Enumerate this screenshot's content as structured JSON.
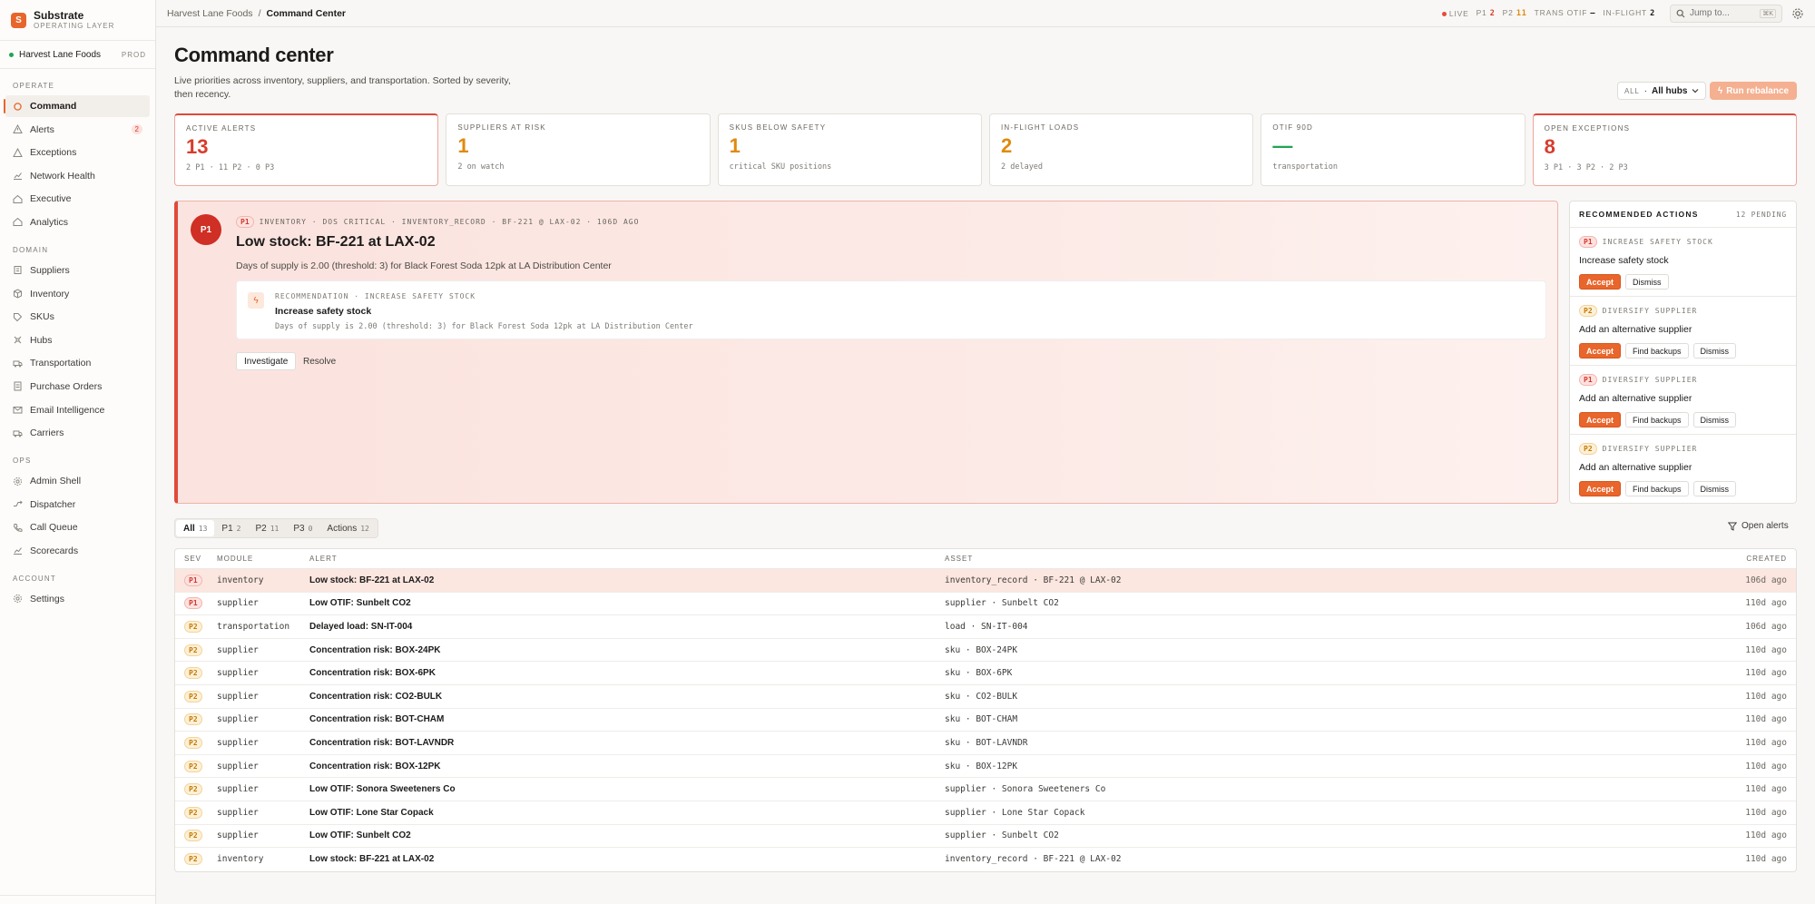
{
  "brand": {
    "name": "Substrate",
    "subtitle": "OPERATING LAYER",
    "logo_letter": "S"
  },
  "org": {
    "name": "Harvest Lane Foods",
    "env": "PROD"
  },
  "nav": {
    "sections": [
      {
        "label": "OPERATE",
        "items": [
          {
            "label": "Command",
            "icon": "circle-icon",
            "active": true
          },
          {
            "label": "Alerts",
            "icon": "warning-icon",
            "badge": "2"
          },
          {
            "label": "Exceptions",
            "icon": "triangle-icon"
          },
          {
            "label": "Network Health",
            "icon": "chart-icon"
          },
          {
            "label": "Executive",
            "icon": "home-icon"
          },
          {
            "label": "Analytics",
            "icon": "home-icon"
          }
        ]
      },
      {
        "label": "DOMAIN",
        "items": [
          {
            "label": "Suppliers",
            "icon": "building-icon"
          },
          {
            "label": "Inventory",
            "icon": "box-icon"
          },
          {
            "label": "SKUs",
            "icon": "tag-icon"
          },
          {
            "label": "Hubs",
            "icon": "hub-icon"
          },
          {
            "label": "Transportation",
            "icon": "truck-icon"
          },
          {
            "label": "Purchase Orders",
            "icon": "document-icon"
          },
          {
            "label": "Email Intelligence",
            "icon": "mail-icon"
          },
          {
            "label": "Carriers",
            "icon": "truck-icon"
          }
        ]
      },
      {
        "label": "OPS",
        "items": [
          {
            "label": "Admin Shell",
            "icon": "gear-icon"
          },
          {
            "label": "Dispatcher",
            "icon": "route-icon"
          },
          {
            "label": "Call Queue",
            "icon": "phone-icon"
          },
          {
            "label": "Scorecards",
            "icon": "chart-icon"
          }
        ]
      },
      {
        "label": "ACCOUNT",
        "items": [
          {
            "label": "Settings",
            "icon": "gear-icon"
          }
        ]
      }
    ]
  },
  "topbar": {
    "breadcrumb": [
      "Harvest Lane Foods",
      "Command Center"
    ],
    "live_label": "LIVE",
    "p1_label": "P1",
    "p1_count": "2",
    "p2_label": "P2",
    "p2_count": "11",
    "otif_label": "TRANS OTIF",
    "otif_value": "—",
    "inflight_label": "IN-FLIGHT",
    "inflight_value": "2",
    "jump_placeholder": "Jump to...",
    "jump_kbd": "⌘K"
  },
  "header": {
    "title": "Command center",
    "subtitle": "Live priorities across inventory, suppliers, and transportation. Sorted by severity, then recency.",
    "hub_filter_label": "ALL",
    "hub_filter_value": "All hubs",
    "rebalance_label": "Run rebalance"
  },
  "kpis": [
    {
      "label": "ACTIVE ALERTS",
      "value": "13",
      "sub": "2 P1 · 11 P2 · 0 P3",
      "color": "red",
      "highlight": true
    },
    {
      "label": "SUPPLIERS AT RISK",
      "value": "1",
      "sub": "2 on watch",
      "color": "amber"
    },
    {
      "label": "SKUS BELOW SAFETY",
      "value": "1",
      "sub": "critical SKU positions",
      "color": "amber"
    },
    {
      "label": "IN-FLIGHT LOADS",
      "value": "2",
      "sub": "2 delayed",
      "color": "amber"
    },
    {
      "label": "OTIF 90D",
      "value": "—",
      "sub": "transportation",
      "color": "green"
    },
    {
      "label": "OPEN EXCEPTIONS",
      "value": "8",
      "sub": "3 P1 · 3 P2 · 2 P3",
      "color": "red",
      "highlight": true
    }
  ],
  "featured_alert": {
    "severity": "P1",
    "meta_pill": "P1",
    "meta": "INVENTORY · DOS CRITICAL · INVENTORY_RECORD · BF-221 @ LAX-02 · 106D AGO",
    "title": "Low stock: BF-221 at LAX-02",
    "description": "Days of supply is 2.00 (threshold: 3) for Black Forest Soda 12pk at LA Distribution Center",
    "recommendation": {
      "meta": "RECOMMENDATION · INCREASE SAFETY STOCK",
      "title": "Increase safety stock",
      "description": "Days of supply is 2.00 (threshold: 3) for Black Forest Soda 12pk at LA Distribution Center"
    },
    "investigate_label": "Investigate",
    "resolve_label": "Resolve"
  },
  "recommended_actions": {
    "title": "RECOMMENDED ACTIONS",
    "pending": "12 PENDING",
    "items": [
      {
        "sev": "P1",
        "type": "INCREASE SAFETY STOCK",
        "title": "Increase safety stock",
        "buttons": [
          "Accept",
          "Dismiss"
        ]
      },
      {
        "sev": "P2",
        "type": "DIVERSIFY SUPPLIER",
        "title": "Add an alternative supplier",
        "buttons": [
          "Accept",
          "Find backups",
          "Dismiss"
        ]
      },
      {
        "sev": "P1",
        "type": "DIVERSIFY SUPPLIER",
        "title": "Add an alternative supplier",
        "buttons": [
          "Accept",
          "Find backups",
          "Dismiss"
        ]
      },
      {
        "sev": "P2",
        "type": "DIVERSIFY SUPPLIER",
        "title": "Add an alternative supplier",
        "buttons": [
          "Accept",
          "Find backups",
          "Dismiss"
        ]
      }
    ]
  },
  "filter_tabs": [
    {
      "label": "All",
      "count": "13",
      "active": true
    },
    {
      "label": "P1",
      "count": "2"
    },
    {
      "label": "P2",
      "count": "11"
    },
    {
      "label": "P3",
      "count": "0"
    },
    {
      "label": "Actions",
      "count": "12"
    }
  ],
  "open_alerts_label": "Open alerts",
  "table": {
    "headers": {
      "sev": "SEV",
      "module": "MODULE",
      "alert": "ALERT",
      "asset": "ASSET",
      "created": "CREATED"
    },
    "rows": [
      {
        "sev": "P1",
        "module": "inventory",
        "alert": "Low stock: BF-221 at LAX-02",
        "asset": "inventory_record · BF-221 @ LAX-02",
        "created": "106d ago",
        "highlight": true
      },
      {
        "sev": "P1",
        "module": "supplier",
        "alert": "Low OTIF: Sunbelt CO2",
        "asset": "supplier · Sunbelt CO2",
        "created": "110d ago"
      },
      {
        "sev": "P2",
        "module": "transportation",
        "alert": "Delayed load: SN-IT-004",
        "asset": "load · SN-IT-004",
        "created": "106d ago"
      },
      {
        "sev": "P2",
        "module": "supplier",
        "alert": "Concentration risk: BOX-24PK",
        "asset": "sku · BOX-24PK",
        "created": "110d ago"
      },
      {
        "sev": "P2",
        "module": "supplier",
        "alert": "Concentration risk: BOX-6PK",
        "asset": "sku · BOX-6PK",
        "created": "110d ago"
      },
      {
        "sev": "P2",
        "module": "supplier",
        "alert": "Concentration risk: CO2-BULK",
        "asset": "sku · CO2-BULK",
        "created": "110d ago"
      },
      {
        "sev": "P2",
        "module": "supplier",
        "alert": "Concentration risk: BOT-CHAM",
        "asset": "sku · BOT-CHAM",
        "created": "110d ago"
      },
      {
        "sev": "P2",
        "module": "supplier",
        "alert": "Concentration risk: BOT-LAVNDR",
        "asset": "sku · BOT-LAVNDR",
        "created": "110d ago"
      },
      {
        "sev": "P2",
        "module": "supplier",
        "alert": "Concentration risk: BOX-12PK",
        "asset": "sku · BOX-12PK",
        "created": "110d ago"
      },
      {
        "sev": "P2",
        "module": "supplier",
        "alert": "Low OTIF: Sonora Sweeteners Co",
        "asset": "supplier · Sonora Sweeteners Co",
        "created": "110d ago"
      },
      {
        "sev": "P2",
        "module": "supplier",
        "alert": "Low OTIF: Lone Star Copack",
        "asset": "supplier · Lone Star Copack",
        "created": "110d ago"
      },
      {
        "sev": "P2",
        "module": "supplier",
        "alert": "Low OTIF: Sunbelt CO2",
        "asset": "supplier · Sunbelt CO2",
        "created": "110d ago"
      },
      {
        "sev": "P2",
        "module": "inventory",
        "alert": "Low stock: BF-221 at LAX-02",
        "asset": "inventory_record · BF-221 @ LAX-02",
        "created": "110d ago"
      }
    ]
  }
}
